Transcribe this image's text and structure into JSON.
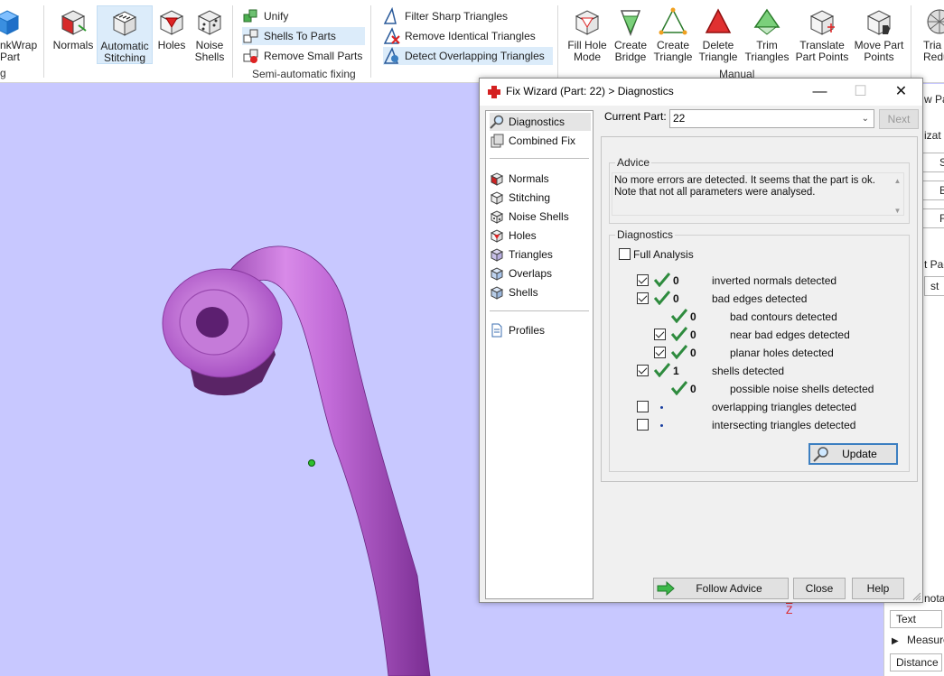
{
  "ribbon": {
    "wrap_label_1": "nkWrap",
    "wrap_label_2": "Part",
    "left_stub_label": "g",
    "normals": "Normals",
    "auto_stitch_1": "Automatic",
    "auto_stitch_2": "Stitching",
    "holes": "Holes",
    "noise_1": "Noise",
    "noise_2": "Shells",
    "unify": "Unify",
    "shells_to_parts": "Shells To Parts",
    "remove_small": "Remove Small Parts",
    "semi_auto_label": "Semi-automatic fixing",
    "filter_sharp": "Filter Sharp Triangles",
    "remove_identical": "Remove Identical Triangles",
    "detect_overlap": "Detect Overlapping Triangles",
    "fill_hole_1": "Fill Hole",
    "fill_hole_2": "Mode",
    "create_bridge_1": "Create",
    "create_bridge_2": "Bridge",
    "create_tri_1": "Create",
    "create_tri_2": "Triangle",
    "delete_tri_1": "Delete",
    "delete_tri_2": "Triangle",
    "trim_1": "Trim",
    "trim_2": "Triangles",
    "translate_1": "Translate",
    "translate_2": "Part Points",
    "move_1": "Move Part",
    "move_2": "Points",
    "tria_1": "Tria",
    "tria_2": "Redu",
    "manual_label": "Manual"
  },
  "dialog": {
    "title": "Fix Wizard (Part: 22) > Diagnostics",
    "nav": [
      {
        "label": "Diagnostics",
        "icon": "magnifier-icon"
      },
      {
        "label": "Combined Fix",
        "icon": "combined-fix-icon"
      },
      {
        "label": "Normals",
        "icon": "normals-cube-icon"
      },
      {
        "label": "Stitching",
        "icon": "stitching-icon"
      },
      {
        "label": "Noise Shells",
        "icon": "noise-shells-icon"
      },
      {
        "label": "Holes",
        "icon": "holes-icon"
      },
      {
        "label": "Triangles",
        "icon": "triangles-icon"
      },
      {
        "label": "Overlaps",
        "icon": "overlaps-icon"
      },
      {
        "label": "Shells",
        "icon": "shells-icon"
      },
      {
        "label": "Profiles",
        "icon": "profiles-document-icon"
      }
    ],
    "current_part_label": "Current Part:",
    "current_part_value": "22",
    "next_label": "Next",
    "advice_title": "Advice",
    "advice_text": "No more errors are detected. It seems that the part is ok. Note that not all parameters were analysed.",
    "diagnostics_title": "Diagnostics",
    "full_analysis_label": "Full Analysis",
    "rows": [
      {
        "count": "0",
        "label": "inverted normals detected"
      },
      {
        "count": "0",
        "label": "bad edges detected"
      },
      {
        "count": "0",
        "label": "bad contours detected"
      },
      {
        "count": "0",
        "label": "near bad edges detected"
      },
      {
        "count": "0",
        "label": "planar holes detected"
      },
      {
        "count": "1",
        "label": "shells detected"
      },
      {
        "count": "0",
        "label": "possible noise shells detected"
      },
      {
        "count": "",
        "label": "overlapping triangles detected"
      },
      {
        "count": "",
        "label": "intersecting triangles detected"
      }
    ],
    "update_label": "Update",
    "follow_advice_label": "Follow Advice",
    "close_label": "Close",
    "help_label": "Help"
  },
  "side_panel": {
    "t1": "w Pa",
    "t2": "izat",
    "t3": "S",
    "t4": "B",
    "t5": "F",
    "t6": "t Pag",
    "t7": "st",
    "t8": "notat",
    "text_field": "Text",
    "measure": "Measure",
    "distance": "Distance"
  },
  "viewport": {
    "axis_label": "Z"
  },
  "colors": {
    "viewport_bg": "#c8c8ff",
    "model": "#c66fd8",
    "ok_check": "#2e8b3e",
    "accent": "#3c7fc1"
  }
}
